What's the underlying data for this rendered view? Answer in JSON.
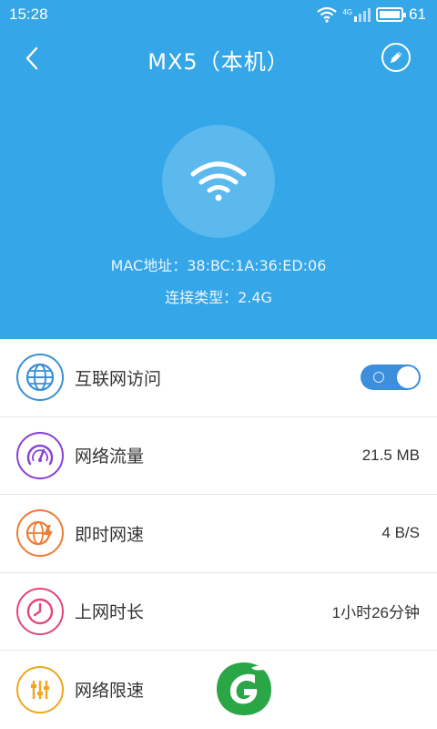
{
  "status_bar": {
    "time": "15:28",
    "network_type": "4G",
    "battery_level": "61"
  },
  "header": {
    "title": "MX5（本机）",
    "mac_line": "MAC地址：38:BC:1A:36:ED:06",
    "connection_line": "连接类型：2.4G"
  },
  "list": {
    "items": [
      {
        "label": "互联网访问",
        "toggle_on": true
      },
      {
        "label": "网络流量",
        "value": "21.5 MB"
      },
      {
        "label": "即时网速",
        "value": "4 B/S"
      },
      {
        "label": "上网时长",
        "value": "1小时26分钟"
      },
      {
        "label": "网络限速"
      }
    ]
  },
  "colors": {
    "header_bg": "#35a6e8",
    "internet_icon": "#3a8fd6",
    "traffic_icon": "#8b3fd6",
    "speed_icon": "#ef7c34",
    "duration_icon": "#e3457a",
    "limit_icon": "#f2a51d",
    "toggle_on": "#3d8fdc",
    "logo_green": "#2aa646"
  }
}
